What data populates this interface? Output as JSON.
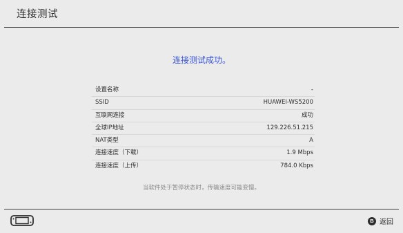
{
  "header": {
    "title": "连接测试"
  },
  "result": {
    "message": "连接测试成功。"
  },
  "info": [
    {
      "label": "设置名称",
      "value": "-"
    },
    {
      "label": "SSID",
      "value": "HUAWEI-WS5200"
    },
    {
      "label": "互联网连接",
      "value": "成功"
    },
    {
      "label": "全球IP地址",
      "value": "129.226.51.215"
    },
    {
      "label": "NAT类型",
      "value": "A"
    },
    {
      "label": "连接速度（下载）",
      "value": "1.9 Mbps"
    },
    {
      "label": "连接速度（上传）",
      "value": "784.0 Kbps"
    }
  ],
  "note": "当软件处于暂停状态时，传输速度可能变慢。",
  "footer": {
    "console_icon": "switch-console-icon",
    "back_button_glyph": "B",
    "back_label": "返回"
  },
  "colors": {
    "background": "#ebebeb",
    "accent": "#3a56d6",
    "text": "#2d2d2d",
    "note_text": "#8a8a8a"
  }
}
